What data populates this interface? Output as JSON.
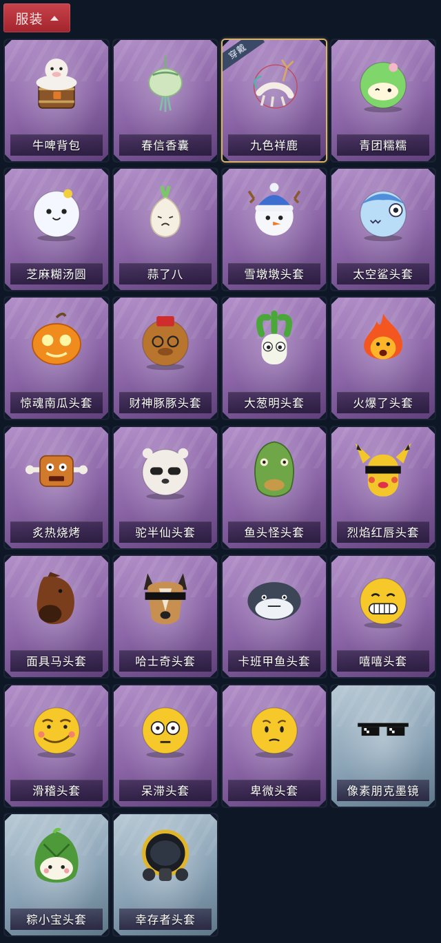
{
  "header": {
    "tab_label": "服装"
  },
  "items": [
    {
      "name": "牛啤背包",
      "rarity": "purple",
      "icon": "beer-cow-backpack-icon"
    },
    {
      "name": "春信香囊",
      "rarity": "purple",
      "icon": "sachet-icon"
    },
    {
      "name": "九色祥鹿",
      "rarity": "purple",
      "icon": "deer-icon",
      "badge": "穿戴"
    },
    {
      "name": "青团糯糯",
      "rarity": "purple",
      "icon": "green-dumpling-icon"
    },
    {
      "name": "芝麻糊汤圆",
      "rarity": "purple",
      "icon": "tangyuan-icon"
    },
    {
      "name": "蒜了八",
      "rarity": "purple",
      "icon": "garlic-icon"
    },
    {
      "name": "雪墩墩头套",
      "rarity": "purple",
      "icon": "snowman-head-icon"
    },
    {
      "name": "太空鲨头套",
      "rarity": "purple",
      "icon": "shark-head-icon"
    },
    {
      "name": "惊魂南瓜头套",
      "rarity": "purple",
      "icon": "pumpkin-head-icon"
    },
    {
      "name": "财神豚豚头套",
      "rarity": "purple",
      "icon": "capybara-head-icon"
    },
    {
      "name": "大葱明头套",
      "rarity": "purple",
      "icon": "scallion-head-icon"
    },
    {
      "name": "火爆了头套",
      "rarity": "purple",
      "icon": "flame-head-icon"
    },
    {
      "name": "炙热烧烤",
      "rarity": "purple",
      "icon": "bbq-meat-icon"
    },
    {
      "name": "驼半仙头套",
      "rarity": "purple",
      "icon": "alpaca-head-icon"
    },
    {
      "name": "鱼头怪头套",
      "rarity": "purple",
      "icon": "fish-head-icon"
    },
    {
      "name": "烈焰红唇头套",
      "rarity": "purple",
      "icon": "pikachu-head-icon"
    },
    {
      "name": "面具马头套",
      "rarity": "purple",
      "icon": "horse-mask-icon"
    },
    {
      "name": "哈士奇头套",
      "rarity": "purple",
      "icon": "husky-head-icon"
    },
    {
      "name": "卡班甲鱼头套",
      "rarity": "purple",
      "icon": "seal-head-icon"
    },
    {
      "name": "嘻嘻头套",
      "rarity": "purple",
      "icon": "grin-emoji-icon"
    },
    {
      "name": "滑稽头套",
      "rarity": "purple",
      "icon": "funny-emoji-icon"
    },
    {
      "name": "呆滞头套",
      "rarity": "purple",
      "icon": "stare-emoji-icon"
    },
    {
      "name": "卑微头套",
      "rarity": "purple",
      "icon": "humble-emoji-icon"
    },
    {
      "name": "像素朋克墨镜",
      "rarity": "blue",
      "icon": "pixel-sunglasses-icon"
    },
    {
      "name": "粽小宝头套",
      "rarity": "blue",
      "icon": "zongzi-head-icon"
    },
    {
      "name": "幸存者头套",
      "rarity": "blue",
      "icon": "gas-mask-icon"
    }
  ]
}
